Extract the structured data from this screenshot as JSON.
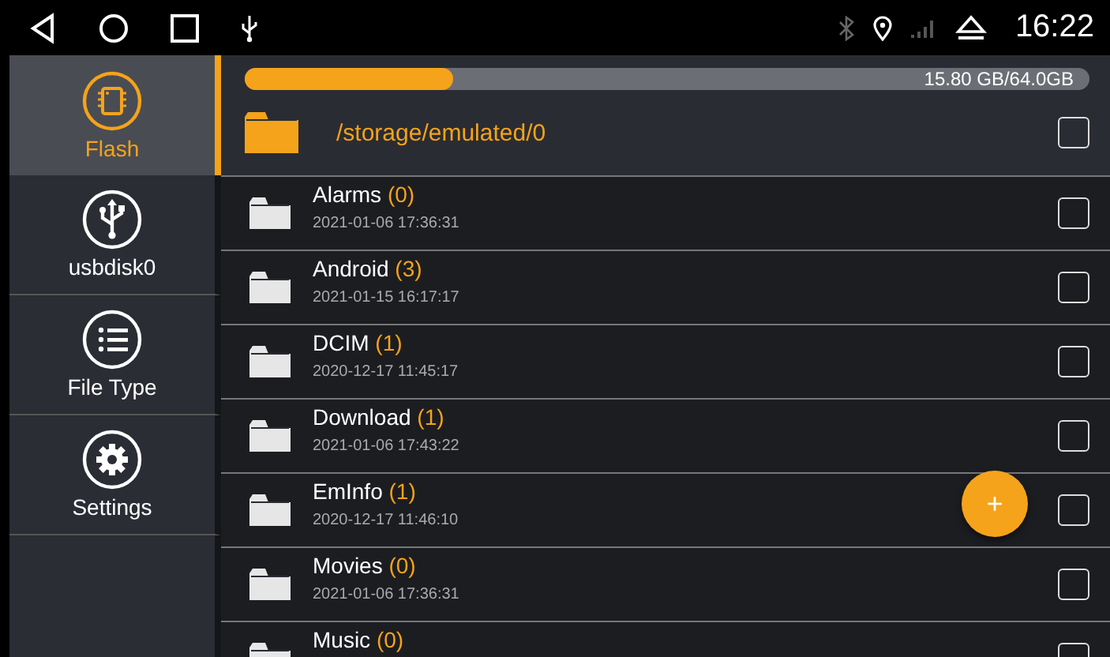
{
  "status_bar": {
    "time": "16:22"
  },
  "sidebar": {
    "items": [
      {
        "label": "Flash",
        "kind": "flash",
        "selected": true
      },
      {
        "label": "usbdisk0",
        "kind": "usb",
        "selected": false
      },
      {
        "label": "File Type",
        "kind": "list",
        "selected": false
      },
      {
        "label": "Settings",
        "kind": "settings",
        "selected": false
      }
    ]
  },
  "storage": {
    "level": 0.247,
    "reading": "15.80 GB/64.0GB"
  },
  "path": {
    "text": "/storage/emulated/0",
    "checked": false
  },
  "files": [
    {
      "name": "Alarms",
      "count": "(0)",
      "date": "2021-01-06 17:36:31",
      "checked": false
    },
    {
      "name": "Android",
      "count": "(3)",
      "date": "2021-01-15 16:17:17",
      "checked": false
    },
    {
      "name": "DCIM",
      "count": "(1)",
      "date": "2020-12-17 11:45:17",
      "checked": false
    },
    {
      "name": "Download",
      "count": "(1)",
      "date": "2021-01-06 17:43:22",
      "checked": false
    },
    {
      "name": "EmInfo",
      "count": "(1)",
      "date": "2020-12-17 11:46:10",
      "checked": false
    },
    {
      "name": "Movies",
      "count": "(0)",
      "date": "2021-01-06 17:36:31",
      "checked": false
    },
    {
      "name": "Music",
      "count": "(0)",
      "checked": false
    }
  ],
  "fab": {
    "label": "+"
  }
}
